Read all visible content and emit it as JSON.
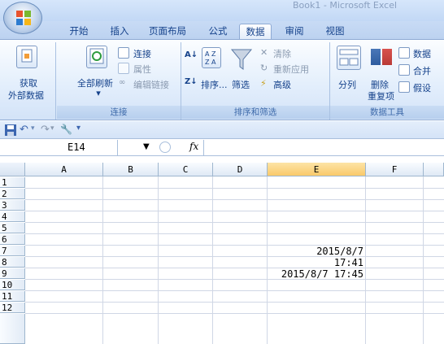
{
  "window": {
    "title": "Book1 - Microsoft Excel"
  },
  "tabs": [
    {
      "label": "开始"
    },
    {
      "label": "插入"
    },
    {
      "label": "页面布局"
    },
    {
      "label": "公式"
    },
    {
      "label": "数据"
    },
    {
      "label": "审阅"
    },
    {
      "label": "视图"
    }
  ],
  "ribbon": {
    "get_external": {
      "line1": "获取",
      "line2": "外部数据"
    },
    "connections": {
      "refresh_all": "全部刷新",
      "connect": "连接",
      "properties": "属性",
      "edit_links": "编辑链接",
      "group_label": "连接"
    },
    "sort_filter": {
      "sort": "排序...",
      "filter": "筛选",
      "clear": "清除",
      "reapply": "重新应用",
      "advanced": "高级",
      "group_label": "排序和筛选"
    },
    "data_tools": {
      "text_to_columns": "分列",
      "remove_dup_1": "删除",
      "remove_dup_2": "重复项",
      "validation": "数据",
      "consolidate": "合并",
      "what_if": "假设",
      "group_label": "数据工具"
    }
  },
  "formula_bar": {
    "name_box": "E14",
    "fx_label": "fx",
    "formula": ""
  },
  "columns": [
    "A",
    "B",
    "C",
    "D",
    "E",
    "F"
  ],
  "rows": [
    "1",
    "2",
    "3",
    "4",
    "5",
    "6",
    "7",
    "8",
    "9",
    "10",
    "11",
    "12"
  ],
  "cells": {
    "E6": "2015/8/7",
    "E7": "17:41",
    "E8": "2015/8/7 17:45"
  },
  "colors": {
    "accent": "#15428b",
    "selected_header": "#f9c96a",
    "ribbon_bg": "#dbe8f8"
  }
}
